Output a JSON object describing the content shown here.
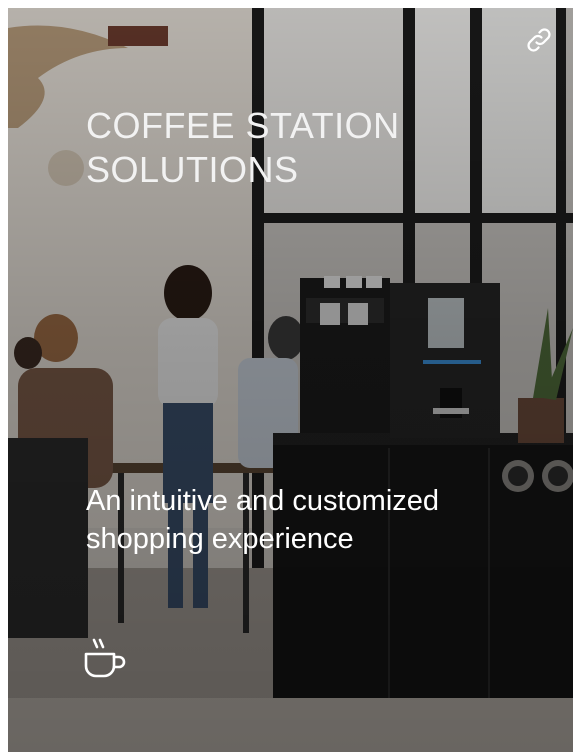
{
  "card": {
    "title_line1": "COFFEE STATION",
    "title_line2": "SOLUTIONS",
    "subtitle": "An intuitive and customized shopping experience",
    "link_icon": "link-icon",
    "category_icon": "coffee-cup-icon"
  }
}
